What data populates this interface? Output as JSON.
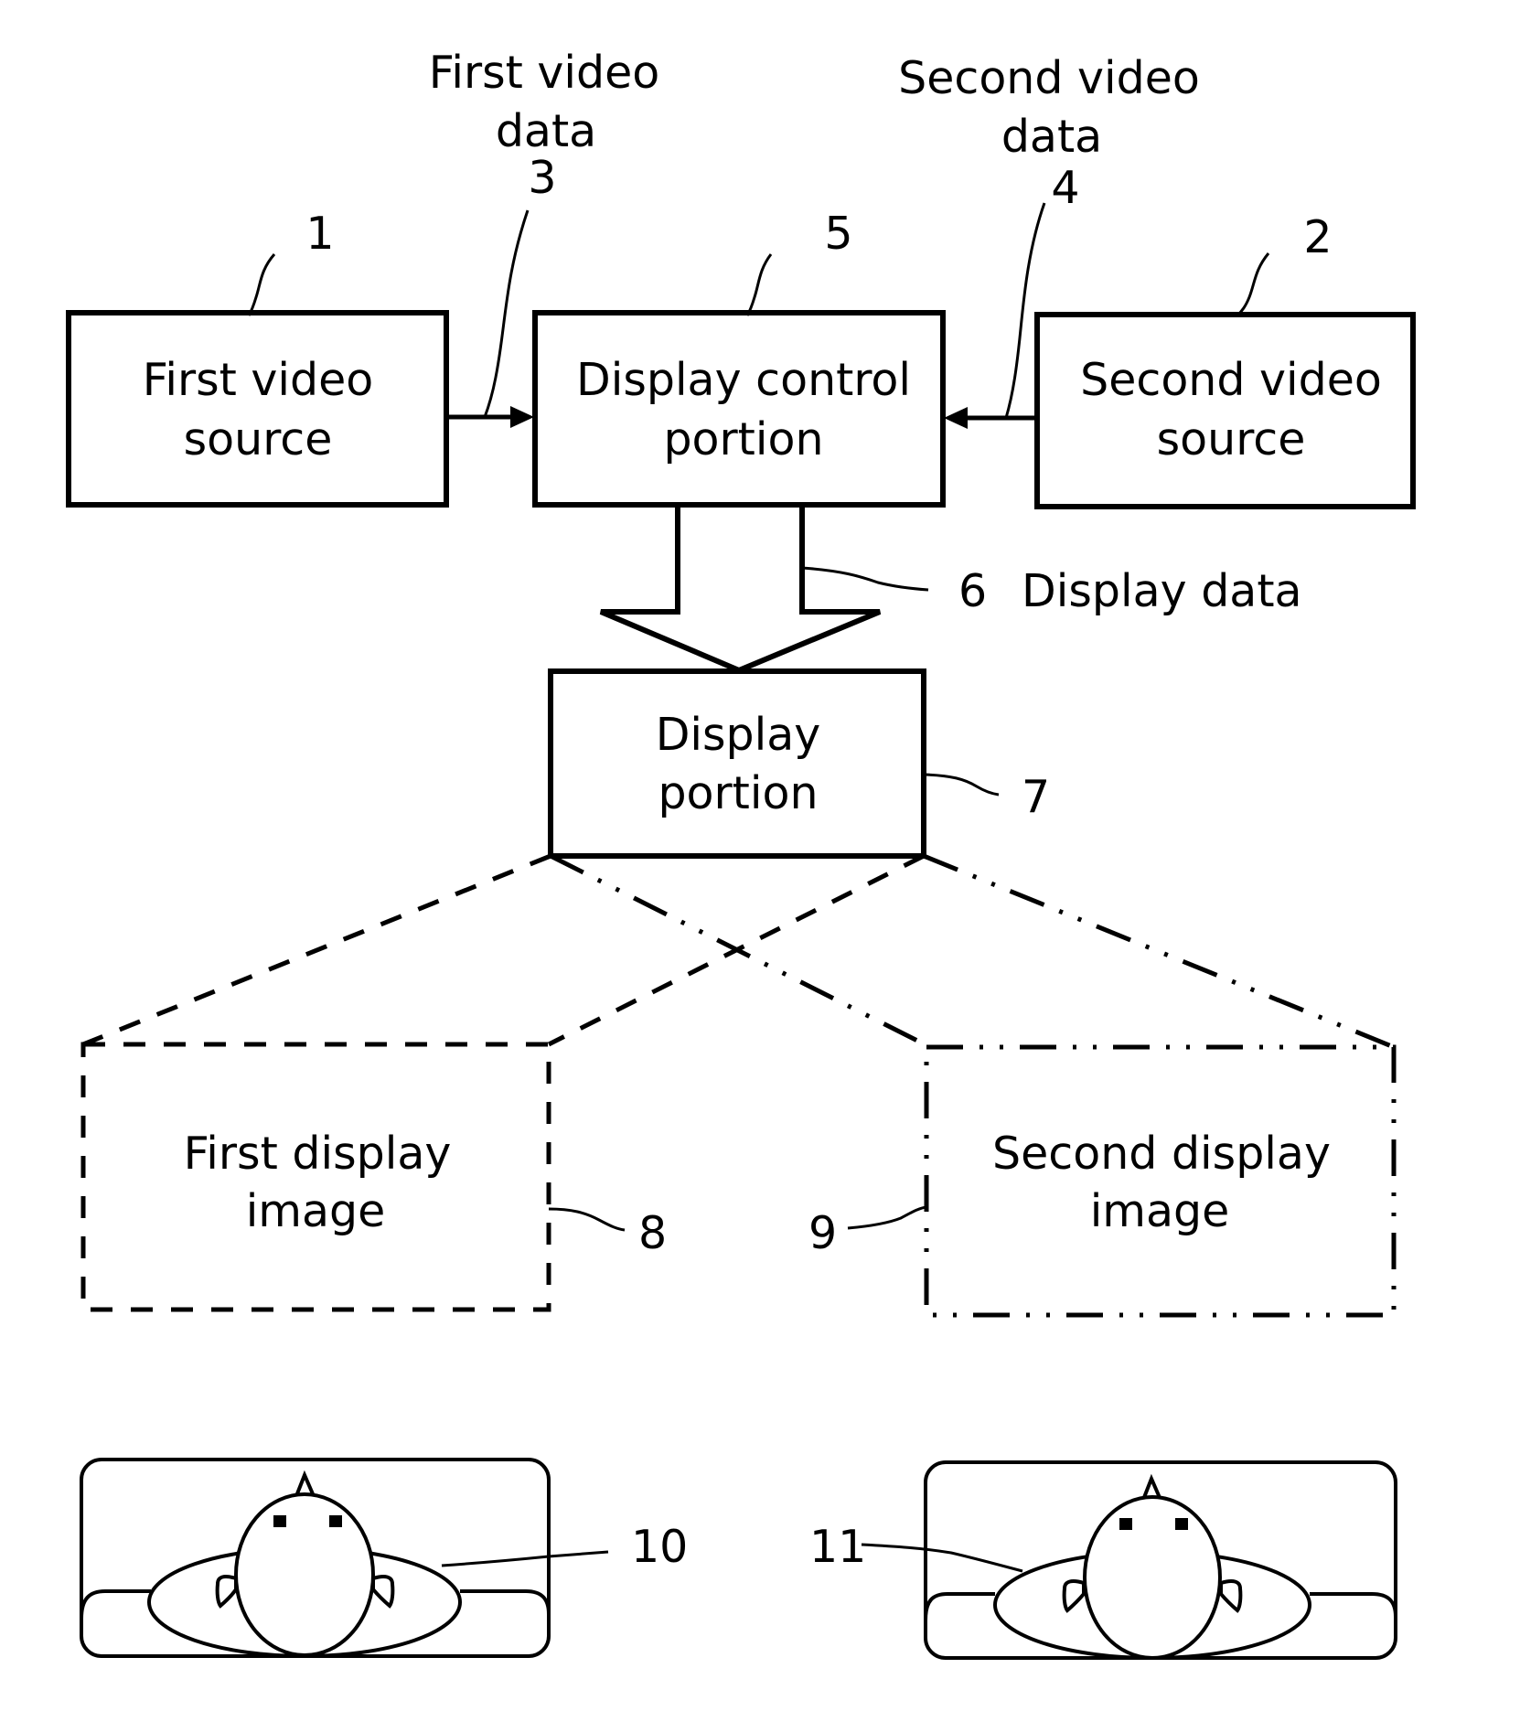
{
  "diagram": {
    "blocks": {
      "first_video_source": {
        "ref": "1",
        "lines": [
          "First video",
          "source"
        ]
      },
      "second_video_source": {
        "ref": "2",
        "lines": [
          "Second video",
          "source"
        ]
      },
      "display_control": {
        "ref": "5",
        "lines": [
          "Display control",
          "portion"
        ]
      },
      "display_portion": {
        "ref": "7",
        "lines": [
          "Display",
          "portion"
        ]
      },
      "first_display_image": {
        "ref": "8",
        "lines": [
          "First display",
          "image"
        ]
      },
      "second_display_image": {
        "ref": "9",
        "lines": [
          "Second display",
          "image"
        ]
      }
    },
    "signals": {
      "first_video_data": {
        "ref": "3",
        "lines": [
          "First video",
          "data"
        ]
      },
      "second_video_data": {
        "ref": "4",
        "lines": [
          "Second video",
          "data"
        ]
      },
      "display_data": {
        "ref": "6",
        "label": "Display data"
      }
    },
    "viewers": {
      "first_viewer": {
        "ref": "10"
      },
      "second_viewer": {
        "ref": "11"
      }
    }
  }
}
